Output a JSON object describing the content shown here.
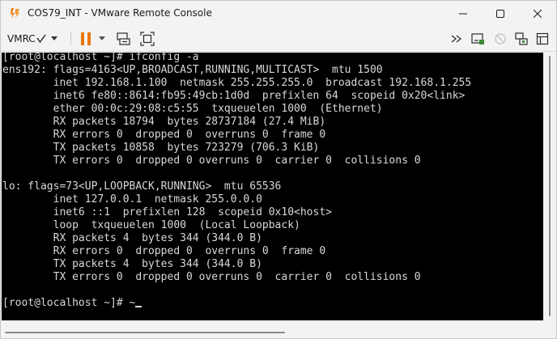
{
  "window": {
    "title": "COS79_INT - VMware Remote Console",
    "icon": "vmware-remote-console-icon"
  },
  "window_controls": {
    "minimize": "minimize-icon",
    "maximize": "maximize-icon",
    "close": "close-icon"
  },
  "toolbar": {
    "menu_label": "VMRC",
    "menu_check": "☑",
    "left_icons": [
      "pause-icon",
      "dropdown-caret-icon",
      "send-ctrl-alt-del-icon",
      "fit-window-icon"
    ],
    "right_icons": [
      "more-icon",
      "removable-devices-icon",
      "disabled-connect-icon",
      "network-settings-icon",
      "library-icon"
    ]
  },
  "colors": {
    "accent": "#e8780a",
    "console_bg": "#000000",
    "console_fg": "#d8d8d8"
  },
  "console": {
    "lines": [
      "[root@localhost ~]# ifconfig -a",
      "ens192: flags=4163<UP,BROADCAST,RUNNING,MULTICAST>  mtu 1500",
      "        inet 192.168.1.100  netmask 255.255.255.0  broadcast 192.168.1.255",
      "        inet6 fe80::8614:fb95:49cb:1d0d  prefixlen 64  scopeid 0x20<link>",
      "        ether 00:0c:29:08:c5:55  txqueuelen 1000  (Ethernet)",
      "        RX packets 18794  bytes 28737184 (27.4 MiB)",
      "        RX errors 0  dropped 0  overruns 0  frame 0",
      "        TX packets 10858  bytes 723279 (706.3 KiB)",
      "        TX errors 0  dropped 0 overruns 0  carrier 0  collisions 0",
      "",
      "lo: flags=73<UP,LOOPBACK,RUNNING>  mtu 65536",
      "        inet 127.0.0.1  netmask 255.0.0.0",
      "        inet6 ::1  prefixlen 128  scopeid 0x10<host>",
      "        loop  txqueuelen 1000  (Local Loopback)",
      "        RX packets 4  bytes 344 (344.0 B)",
      "        RX errors 0  dropped 0  overruns 0  frame 0",
      "        TX packets 4  bytes 344 (344.0 B)",
      "        TX errors 0  dropped 0 overruns 0  carrier 0  collisions 0",
      "",
      "[root@localhost ~]# ~"
    ]
  }
}
